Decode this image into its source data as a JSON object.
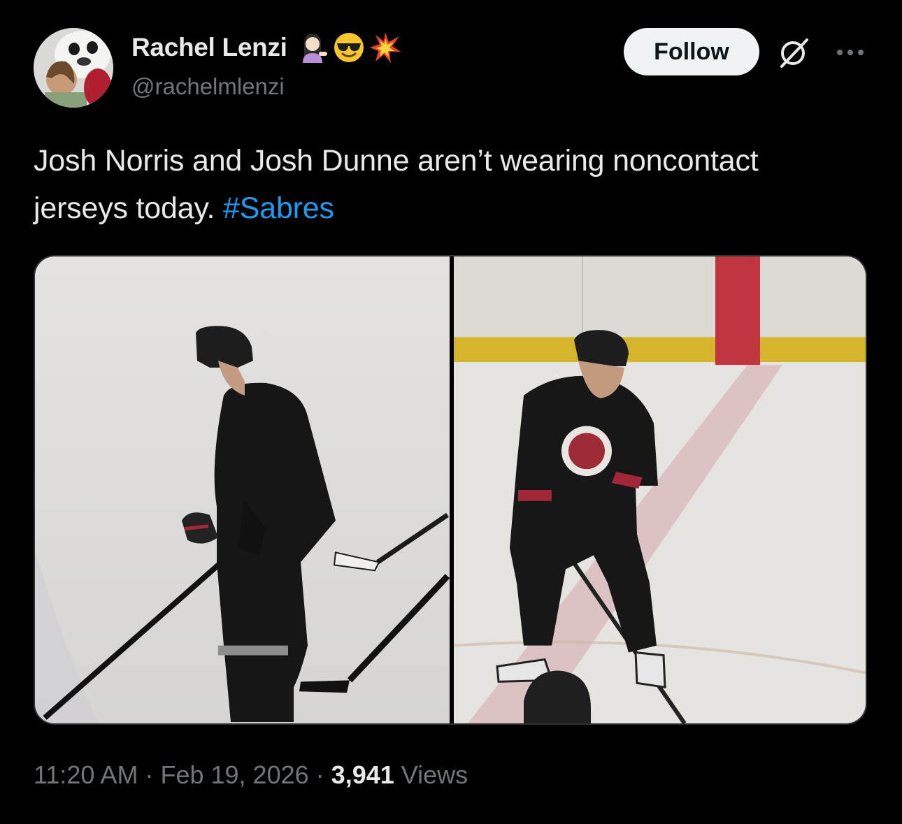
{
  "author": {
    "display_name": "Rachel Lenzi",
    "handle": "@rachelmlenzi",
    "name_emojis": [
      "woman-tipping-hand-icon",
      "sunglasses-face-icon",
      "collision-icon"
    ],
    "avatar": "avatar-photo"
  },
  "actions": {
    "follow_label": "Follow",
    "grok_icon": "grok-icon",
    "more_icon": "more-icon"
  },
  "tweet": {
    "text": "Josh Norris and Josh Dunne aren’t wearing noncontact jerseys today.",
    "hashtag": "#Sabres"
  },
  "media": [
    {
      "name": "photo-left",
      "description": ""
    },
    {
      "name": "photo-right",
      "description": ""
    }
  ],
  "meta": {
    "time": "11:20 AM",
    "separator": "·",
    "date": "Feb 19, 2026",
    "views_count": "3,941",
    "views_label": "Views"
  },
  "colors": {
    "background": "#000000",
    "text_primary": "#e7e9ea",
    "text_secondary": "#71767b",
    "link": "#1d9bf0",
    "follow_bg": "#eff3f4"
  }
}
